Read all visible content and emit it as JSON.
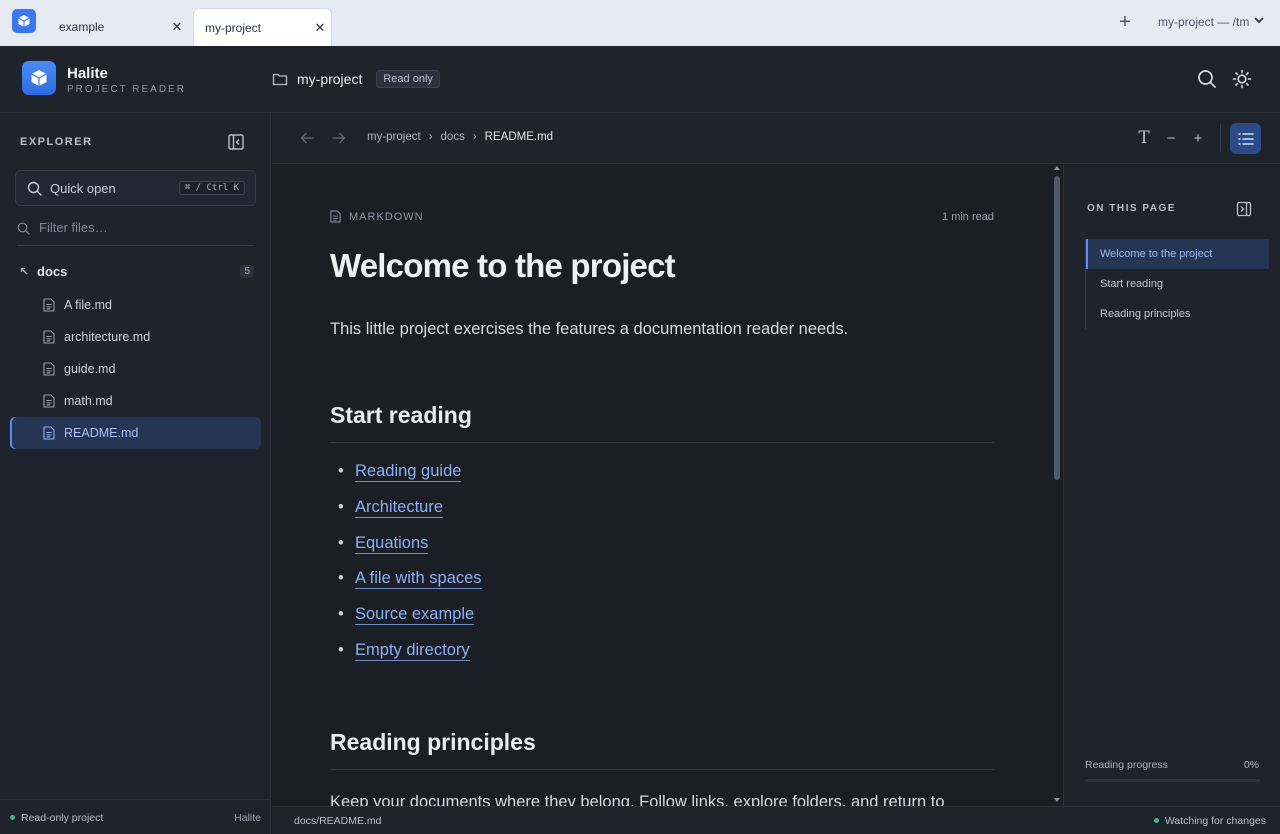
{
  "browser": {
    "tabs": [
      {
        "label": "example",
        "active": false
      },
      {
        "label": "my-project",
        "active": true
      }
    ],
    "new_tab": "+",
    "window_title": "my-project — /tm"
  },
  "header": {
    "brand_name": "Halite",
    "brand_subtitle": "PROJECT READER",
    "project_name": "my-project",
    "mode_badge": "Read only"
  },
  "sidebar": {
    "title": "EXPLORER",
    "quick_open": {
      "label": "Quick open",
      "shortcut": "⌘ / Ctrl K"
    },
    "filter_placeholder": "Filter files…",
    "folder": {
      "name": "docs",
      "count": "5"
    },
    "files": [
      {
        "label": "A file.md",
        "selected": false
      },
      {
        "label": "architecture.md",
        "selected": false
      },
      {
        "label": "guide.md",
        "selected": false
      },
      {
        "label": "math.md",
        "selected": false
      },
      {
        "label": "README.md",
        "selected": true
      }
    ],
    "footer_status": "Read-only project",
    "footer_brand": "Halite"
  },
  "toolbar": {
    "breadcrumb": [
      "my-project",
      "docs",
      "README.md"
    ],
    "font_label": "T",
    "decrease_label": "−",
    "increase_label": "+"
  },
  "document": {
    "kind": "MARKDOWN",
    "read_time": "1 min read",
    "title": "Welcome to the project",
    "lead": "This little project exercises the features a documentation reader needs.",
    "section1": "Start reading",
    "links": [
      "Reading guide",
      "Architecture",
      "Equations",
      "A file with spaces",
      "Source example",
      "Empty directory"
    ],
    "section2": "Reading principles",
    "paragraph": "Keep your documents where they belong. Follow links, explore folders, and return to"
  },
  "toc": {
    "title": "ON THIS PAGE",
    "items": [
      {
        "label": "Welcome to the project",
        "active": true
      },
      {
        "label": "Start reading",
        "active": false
      },
      {
        "label": "Reading principles",
        "active": false
      }
    ],
    "progress_label": "Reading progress",
    "progress_value": "0%",
    "progress_fraction": 0
  },
  "statusbar": {
    "path": "docs/README.md",
    "watch_status": "Watching for changes"
  },
  "colors": {
    "accent": "#5b8cf0",
    "link": "#8ab1f3",
    "status_ok": "#3fb97f",
    "selected_bg": "#253654"
  }
}
